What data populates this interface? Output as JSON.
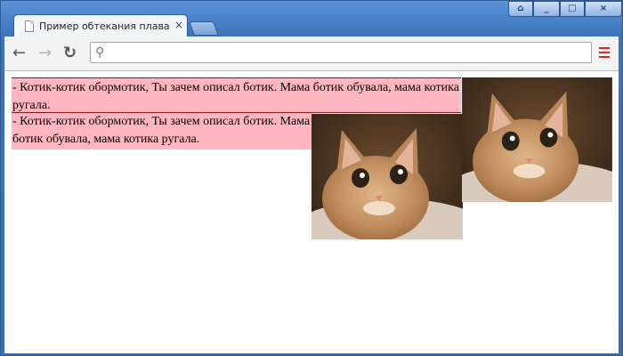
{
  "window": {
    "tab_title": "Пример обтекания плаваю",
    "tab_close": "×",
    "controls": {
      "user": "⌂",
      "minimize": "_",
      "maximize": "□",
      "close": "×"
    }
  },
  "toolbar": {
    "back_icon": "←",
    "forward_icon": "→",
    "reload_icon": "↻",
    "omnibox_value": "",
    "omnibox_placeholder": "",
    "search_icon": "⚲"
  },
  "page": {
    "paragraph1": "- Котик-котик обормотик, Ты зачем описал ботик. Мама ботик обувала, мама котика ругала.",
    "paragraph2": "- Котик-котик обормотик, Ты зачем описал ботик. Мама ботик обувала, мама котика ругала.",
    "image_alt": "cat"
  },
  "colors": {
    "paragraph_bg": "#ffb6c1",
    "menu_accent": "#cc2b2b",
    "frame": "#3b72bb"
  }
}
